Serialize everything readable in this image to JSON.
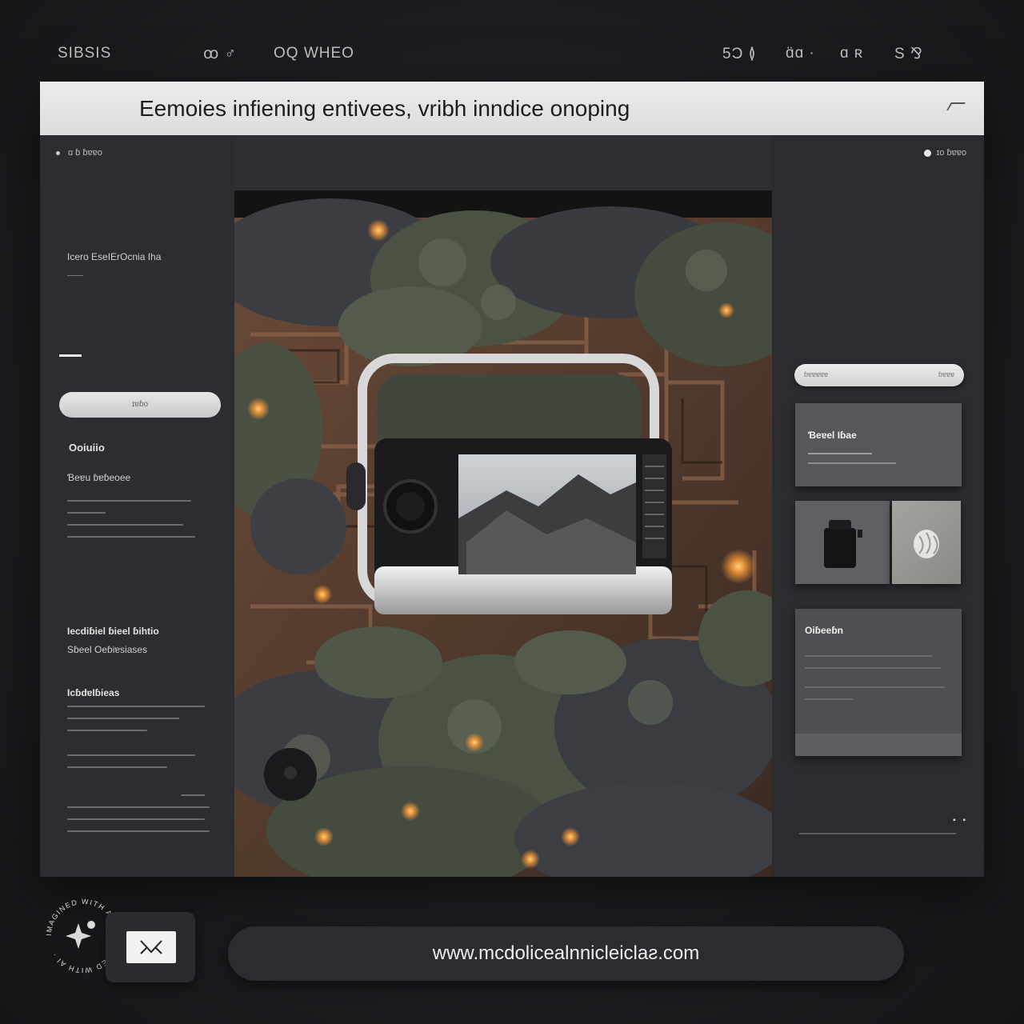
{
  "topnav": {
    "logo": "SIBSIS",
    "icon_text": "ꝏ ♂",
    "link": "OQ WHEO",
    "right_1": "5Ɔ ≬",
    "right_2": "ɑ̈ɑ ·",
    "right_3": "ɑ ʀ",
    "right_4": "S ⅋"
  },
  "window": {
    "title": "Eemoies infiening entivees,  vribh inndice onoping",
    "sub_left": "ɑ ɓ ɓɐɐo",
    "sub_right": "ɪo ɓɐɐo"
  },
  "sidebar_left": {
    "heading": "Icero EseIErOcnia Iha",
    "pill_label": "ɪɐɓo",
    "section_1_title": "Ooiuiio",
    "section_1_sub": "Ɓeɐu ɓɐɓeoee",
    "section_2_title": "Iecdiɓiel ɓieel ɓihtio",
    "section_2_sub": "Sɓeel Oeɓiɐsiases",
    "section_3_title": "IcɓdɐIɓieas"
  },
  "sidebar_right": {
    "search_placeholder": "ɓɐɐɐɐɐ",
    "search_button": "ɓɐɐɐ",
    "card1_title": "Ɓeɐel Iɓae",
    "card2_title": "Oiɓeeɓn",
    "bottom_text": "▪ ▪"
  },
  "badge": {
    "text": "IMAGINED WITH AI · IMAGINED WITH AI ·"
  },
  "url_bar": {
    "url": "www.mcdolicealnnicleiclaƨ.com"
  },
  "colors": {
    "window_bg": "#2e2f33",
    "titlebar_bg": "#e4e4e4",
    "accent_glow": "#f59a3a",
    "moss": "#4b5244",
    "rock": "#3b3b41"
  },
  "icons": {
    "mail": "mail-icon",
    "sparkle": "sparkle-icon",
    "camera": "camera-device-icon"
  }
}
